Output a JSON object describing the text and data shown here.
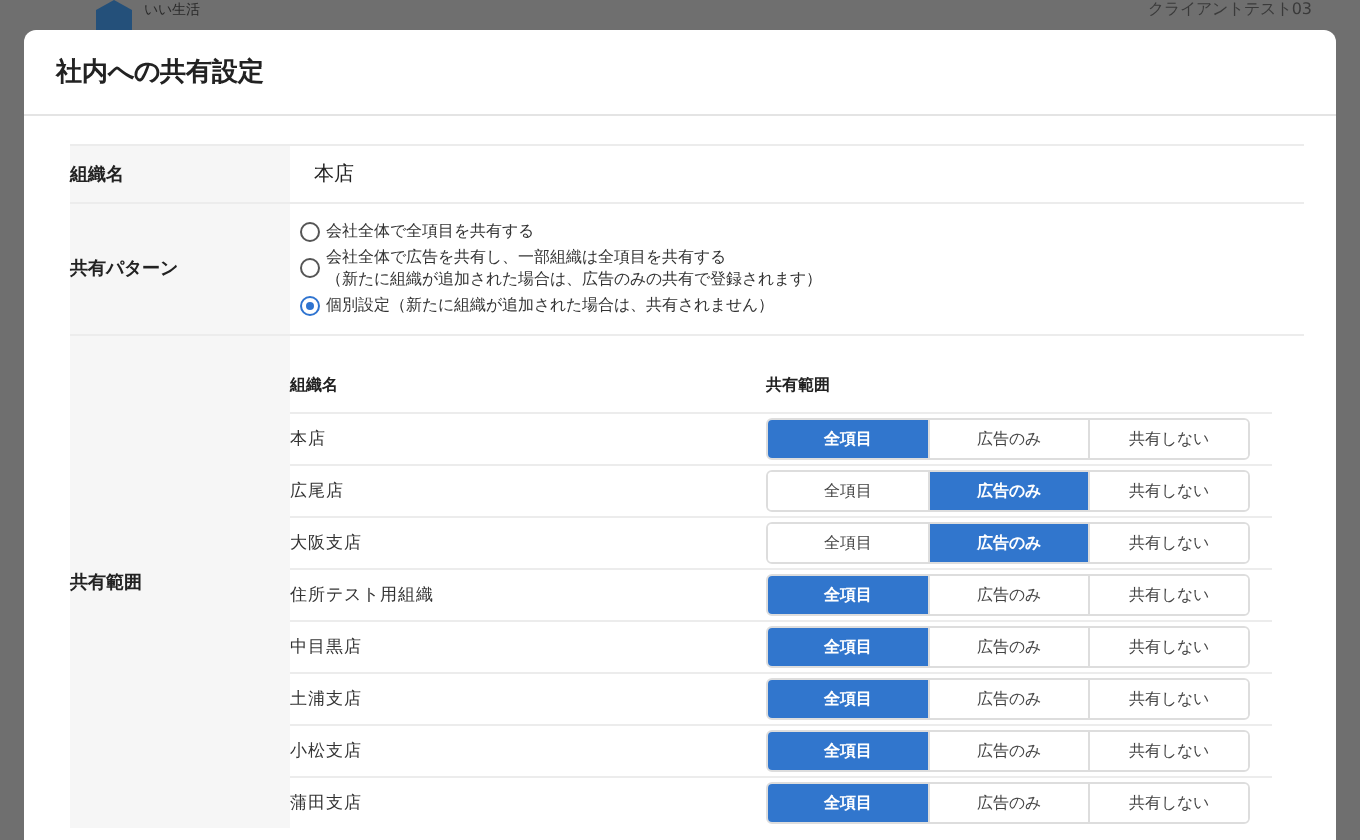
{
  "background": {
    "brand": "いい生活",
    "client_name": "クライアントテスト03"
  },
  "dialog": {
    "title": "社内への共有設定",
    "org_name": {
      "label": "組織名",
      "value": "本店"
    },
    "share_pattern": {
      "label": "共有パターン",
      "options": [
        {
          "lines": [
            "会社全体で全項目を共有する"
          ],
          "selected": false
        },
        {
          "lines": [
            "会社全体で広告を共有し、一部組織は全項目を共有する",
            "（新たに組織が追加された場合は、広告のみの共有で登録されます）"
          ],
          "selected": false
        },
        {
          "lines": [
            "個別設定（新たに組織が追加された場合は、共有されません）"
          ],
          "selected": true
        }
      ]
    },
    "share_scope": {
      "label": "共有範囲",
      "columns": [
        "組織名",
        "共有範囲"
      ],
      "rows": [
        {
          "name": "本店",
          "options": [
            {
              "label": "全項目",
              "selected": true
            },
            {
              "label": "広告のみ",
              "selected": false
            },
            {
              "label": "共有しない",
              "selected": false
            }
          ]
        },
        {
          "name": "広尾店",
          "options": [
            {
              "label": "全項目",
              "selected": false
            },
            {
              "label": "広告のみ",
              "selected": true
            },
            {
              "label": "共有しない",
              "selected": false
            }
          ]
        },
        {
          "name": "大阪支店",
          "options": [
            {
              "label": "全項目",
              "selected": false
            },
            {
              "label": "広告のみ",
              "selected": true
            },
            {
              "label": "共有しない",
              "selected": false
            }
          ]
        },
        {
          "name": "住所テスト用組織",
          "options": [
            {
              "label": "全項目",
              "selected": true
            },
            {
              "label": "広告のみ",
              "selected": false
            },
            {
              "label": "共有しない",
              "selected": false
            }
          ]
        },
        {
          "name": "中目黒店",
          "options": [
            {
              "label": "全項目",
              "selected": true
            },
            {
              "label": "広告のみ",
              "selected": false
            },
            {
              "label": "共有しない",
              "selected": false
            }
          ]
        },
        {
          "name": "土浦支店",
          "options": [
            {
              "label": "全項目",
              "selected": true
            },
            {
              "label": "広告のみ",
              "selected": false
            },
            {
              "label": "共有しない",
              "selected": false
            }
          ]
        },
        {
          "name": "小松支店",
          "options": [
            {
              "label": "全項目",
              "selected": true
            },
            {
              "label": "広告のみ",
              "selected": false
            },
            {
              "label": "共有しない",
              "selected": false
            }
          ]
        },
        {
          "name": "蒲田支店",
          "options": [
            {
              "label": "全項目",
              "selected": true
            },
            {
              "label": "広告のみ",
              "selected": false
            },
            {
              "label": "共有しない",
              "selected": false
            }
          ]
        }
      ]
    }
  }
}
